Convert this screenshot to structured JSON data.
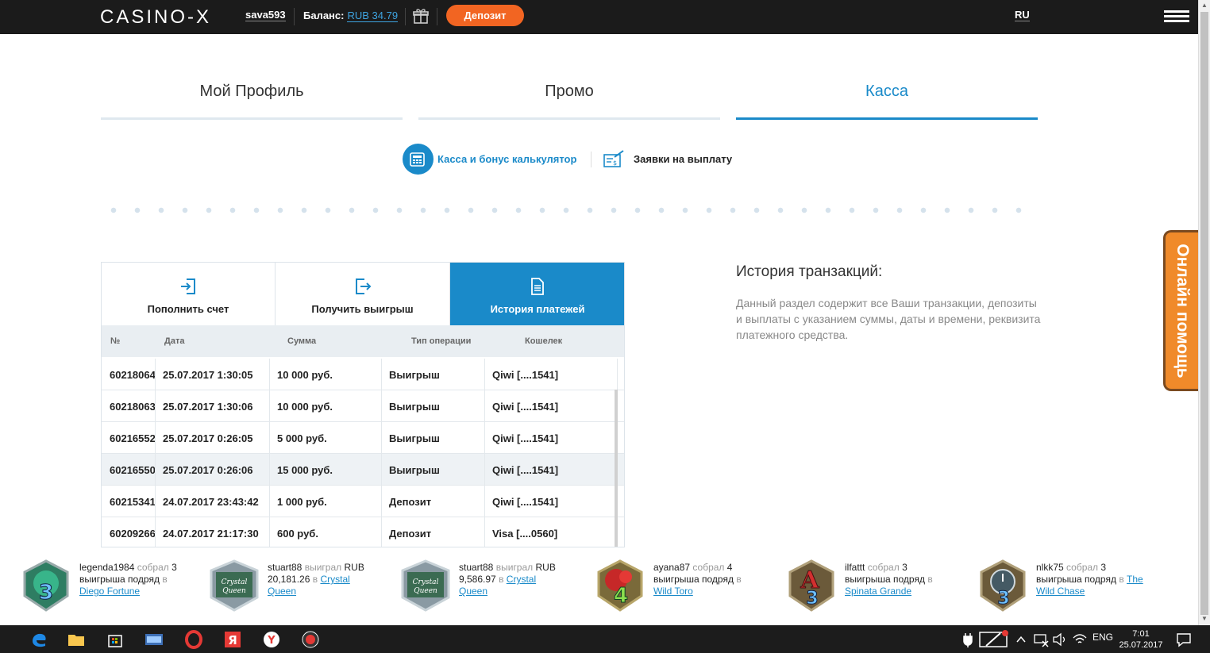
{
  "header": {
    "logo": "CASINO-X",
    "username": "sava593",
    "balance_label": "Баланс:",
    "balance_value": "RUB 34.79",
    "deposit_label": "Депозит",
    "lang": "RU"
  },
  "main_tabs": [
    {
      "label": "Мой Профиль"
    },
    {
      "label": "Промо"
    },
    {
      "label": "Касса"
    }
  ],
  "subnav": {
    "calc_label": "Касса и бонус калькулятор",
    "withdraw_label": "Заявки на выплату"
  },
  "panel": {
    "tabs": [
      {
        "label": "Пополнить счет"
      },
      {
        "label": "Получить выигрыш"
      },
      {
        "label": "История платежей"
      }
    ],
    "columns": [
      "№",
      "Дата",
      "Сумма",
      "Тип операции",
      "Кошелек"
    ],
    "rows": [
      {
        "id": "60218064",
        "date": "25.07.2017 1:30:05",
        "amount": "10 000 руб.",
        "type": "Выигрыш",
        "wallet": "Qiwi [....1541]"
      },
      {
        "id": "60218063",
        "date": "25.07.2017 1:30:06",
        "amount": "10 000 руб.",
        "type": "Выигрыш",
        "wallet": "Qiwi [....1541]"
      },
      {
        "id": "60216552",
        "date": "25.07.2017 0:26:05",
        "amount": "5 000 руб.",
        "type": "Выигрыш",
        "wallet": "Qiwi [....1541]"
      },
      {
        "id": "60216550",
        "date": "25.07.2017 0:26:06",
        "amount": "15 000 руб.",
        "type": "Выигрыш",
        "wallet": "Qiwi [....1541]"
      },
      {
        "id": "60215341",
        "date": "24.07.2017 23:43:42",
        "amount": "1 000 руб.",
        "type": "Депозит",
        "wallet": "Qiwi [....1541]"
      },
      {
        "id": "60209266",
        "date": "24.07.2017 21:17:30",
        "amount": "600 руб.",
        "type": "Депозит",
        "wallet": "Visa [....0560]"
      }
    ]
  },
  "info": {
    "title": "История транзакций:",
    "text": "Данный раздел содержит все Ваши транзакции, депозиты и выплаты с указанием суммы, даты и времени, реквизита платежного средства."
  },
  "help": {
    "label": "Онлайн помощь"
  },
  "winners": [
    {
      "user": "legenda1984",
      "verb": "собрал",
      "count": "3",
      "line2a": "выигрыша подряд",
      "line2b": "в",
      "game": "Diego Fortune",
      "badge": "3"
    },
    {
      "user": "stuart88",
      "verb": "выиграл",
      "amount": "RUB",
      "line2a": "20,181.26",
      "line2b": "в",
      "game1": "Crystal",
      "game2": "Queen",
      "badge": "Crystal Queen"
    },
    {
      "user": "stuart88",
      "verb": "выиграл",
      "amount": "RUB",
      "line2a": "9,586.97",
      "line2b": "в",
      "game1": "Crystal",
      "game2": "Queen",
      "badge": "Crystal Queen"
    },
    {
      "user": "ayana87",
      "verb": "собрал",
      "count": "4",
      "line2a": "выигрыша подряд",
      "line2b": "в",
      "game": "Wild Toro",
      "badge": "4"
    },
    {
      "user": "ilfattt",
      "verb": "собрал",
      "count": "3",
      "line2a": "выигрыша подряд",
      "line2b": "в",
      "game": "Spinata Grande",
      "badge": "3"
    },
    {
      "user": "nlkk75",
      "verb": "собрал",
      "count": "3",
      "line2a": "выигрыша подряд",
      "line2b": "в",
      "game1": "The",
      "game2": "Wild Chase",
      "badge": "3"
    }
  ],
  "taskbar": {
    "lang": "ENG",
    "time": "7:01",
    "date": "25.07.2017"
  },
  "colors": {
    "accent": "#1a8ac9",
    "deposit": "#f26522",
    "help": "#f08a2a",
    "header": "#1b1b1b"
  }
}
